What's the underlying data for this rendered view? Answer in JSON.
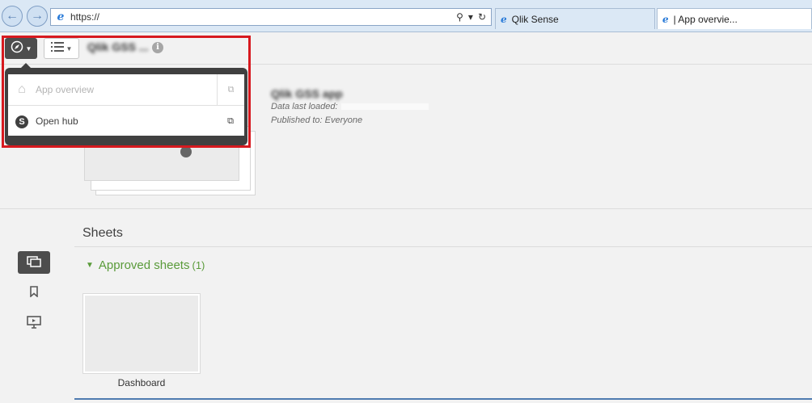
{
  "browser": {
    "url": "https://",
    "tabs": [
      {
        "label": "Qlik Sense"
      },
      {
        "label": "| App overvie..."
      }
    ]
  },
  "toolbar": {
    "app_name": "Qlik GSS ..."
  },
  "navigation_menu": {
    "items": [
      {
        "label": "App overview",
        "icon": "home-icon",
        "enabled": false
      },
      {
        "label": "Open hub",
        "icon": "qlik-hub-icon",
        "enabled": true
      }
    ]
  },
  "overview": {
    "app_title": "Qlik GSS app",
    "data_last_loaded_label": "Data last loaded:",
    "published_to": "Published to: Everyone"
  },
  "sheets": {
    "section_title": "Sheets",
    "approved_label": "Approved sheets",
    "approved_count": "(1)",
    "items": [
      {
        "title": "Dashboard"
      }
    ]
  },
  "colors": {
    "accent_green": "#5a9b3a",
    "highlight_red": "#d7191f",
    "toolbar_dark": "#4d4d4d"
  }
}
